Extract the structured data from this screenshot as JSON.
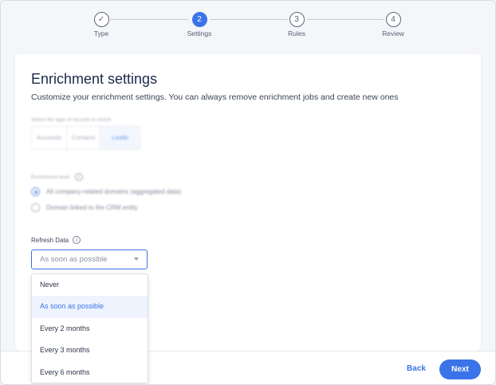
{
  "stepper": {
    "steps": [
      {
        "number": "✓",
        "label": "Type",
        "state": "done"
      },
      {
        "number": "2",
        "label": "Settings",
        "state": "active"
      },
      {
        "number": "3",
        "label": "Rules",
        "state": "todo"
      },
      {
        "number": "4",
        "label": "Review",
        "state": "todo"
      }
    ]
  },
  "card": {
    "title": "Enrichment settings",
    "subtitle": "Customize your enrichment settings. You can always remove enrichment jobs and create new ones",
    "records_label": "Select the type of records to enrich",
    "record_types": [
      "Accounts",
      "Contacts",
      "Leads"
    ],
    "selected_record_type": "Leads",
    "enrichment_level_label": "Enrichment level",
    "enrichment_options": [
      {
        "label": "All company-related domains (aggregated data)",
        "selected": true
      },
      {
        "label": "Domain linked to the CRM entity",
        "selected": false
      }
    ],
    "refresh_label": "Refresh Data",
    "refresh_value": "As soon as possible"
  },
  "dropdown": {
    "options": [
      "Never",
      "As soon as possible",
      "Every 2 months",
      "Every 3 months",
      "Every 6 months"
    ],
    "selected": "As soon as possible"
  },
  "footer": {
    "back_label": "Back",
    "next_label": "Next"
  },
  "colors": {
    "accent": "#3b73e8",
    "background": "#f4f6f9",
    "text": "#1f2a44"
  }
}
